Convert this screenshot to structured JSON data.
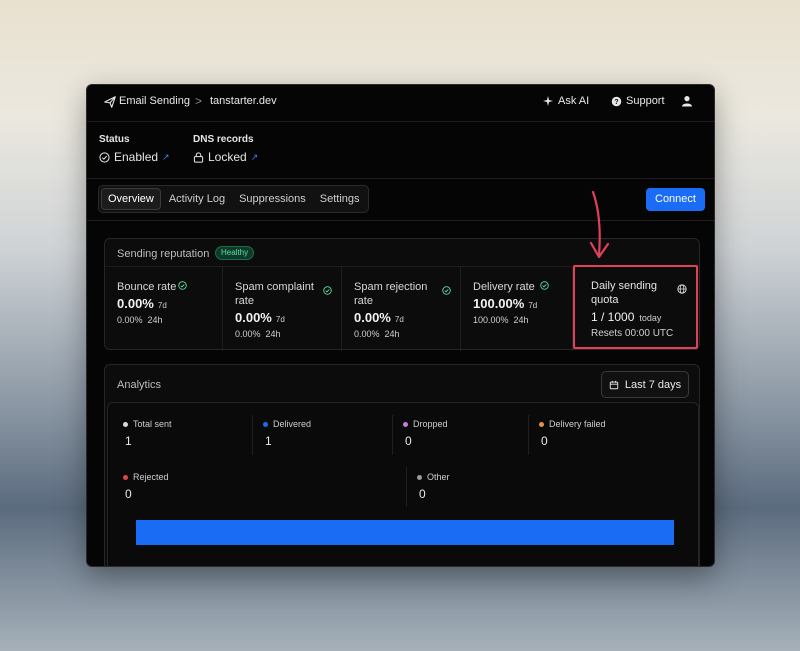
{
  "breadcrumb": {
    "section": "Email Sending",
    "separator": ">",
    "domain": "tanstarter.dev"
  },
  "nav": {
    "ask_ai": "Ask AI",
    "support": "Support"
  },
  "status": {
    "status_label": "Status",
    "status_value": "Enabled",
    "dns_label": "DNS records",
    "dns_value": "Locked",
    "link_glyph": "↗"
  },
  "tabs": [
    {
      "label": "Overview",
      "active": true
    },
    {
      "label": "Activity Log",
      "active": false
    },
    {
      "label": "Suppressions",
      "active": false
    },
    {
      "label": "Settings",
      "active": false
    }
  ],
  "connect_label": "Connect",
  "reputation": {
    "title": "Sending reputation",
    "badge": "Healthy",
    "metrics": [
      {
        "label": "Bounce rate",
        "value_7d": "0.00%",
        "unit_7d": "7d",
        "value_24h": "0.00%",
        "unit_24h": "24h"
      },
      {
        "label": "Spam complaint rate",
        "value_7d": "0.00%",
        "unit_7d": "7d",
        "value_24h": "0.00%",
        "unit_24h": "24h"
      },
      {
        "label": "Spam rejection rate",
        "value_7d": "0.00%",
        "unit_7d": "7d",
        "value_24h": "0.00%",
        "unit_24h": "24h"
      },
      {
        "label": "Delivery rate",
        "value_7d": "100.00%",
        "unit_7d": "7d",
        "value_24h": "100.00%",
        "unit_24h": "24h"
      }
    ],
    "quota": {
      "label": "Daily sending quota",
      "value": "1 / 1000",
      "unit": "today",
      "reset": "Resets 00:00 UTC"
    }
  },
  "analytics": {
    "title": "Analytics",
    "range_label": "Last 7 days",
    "stats": [
      {
        "label": "Total sent",
        "value": "1",
        "color": "#d9d9d9"
      },
      {
        "label": "Delivered",
        "value": "1",
        "color": "#1a6cf5"
      },
      {
        "label": "Dropped",
        "value": "0",
        "color": "#c77ddb"
      },
      {
        "label": "Delivery failed",
        "value": "0",
        "color": "#e8904a"
      },
      {
        "label": "Rejected",
        "value": "0",
        "color": "#e0454e"
      },
      {
        "label": "Other",
        "value": "0",
        "color": "#9a9a9a"
      }
    ],
    "bar_color": "#1a6cf5"
  },
  "colors": {
    "accent": "#1a6cf5",
    "healthy": "#5fdca3",
    "highlight": "#e0405a"
  }
}
